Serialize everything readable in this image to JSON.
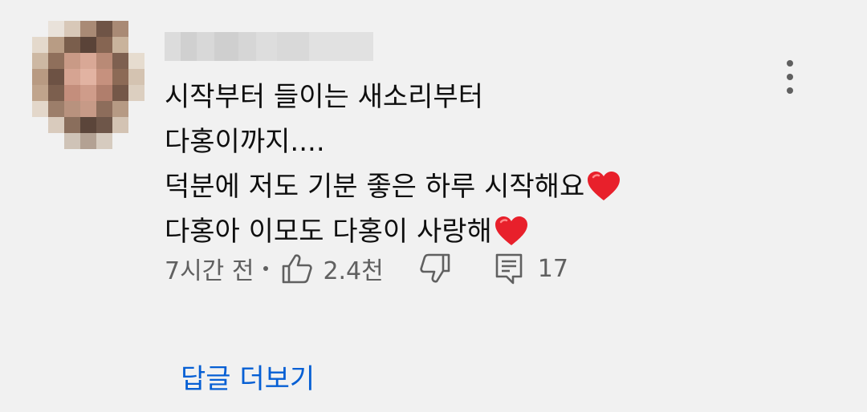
{
  "comment": {
    "text_lines": [
      "시작부터 들이는 새소리부터",
      "다홍이까지....",
      "덕분에 저도 기분 좋은 하루 시작해요",
      "다홍아 이모도 다홍이 사랑해"
    ],
    "time": "7시간 전",
    "like_count": "2.4천",
    "reply_count": "17",
    "more_replies_label": "답글 더보기"
  },
  "colors": {
    "background": "#f1f1f1",
    "text": "#0f0f0f",
    "secondary": "#606060",
    "link": "#065fd4",
    "heart": "#e8202b"
  }
}
